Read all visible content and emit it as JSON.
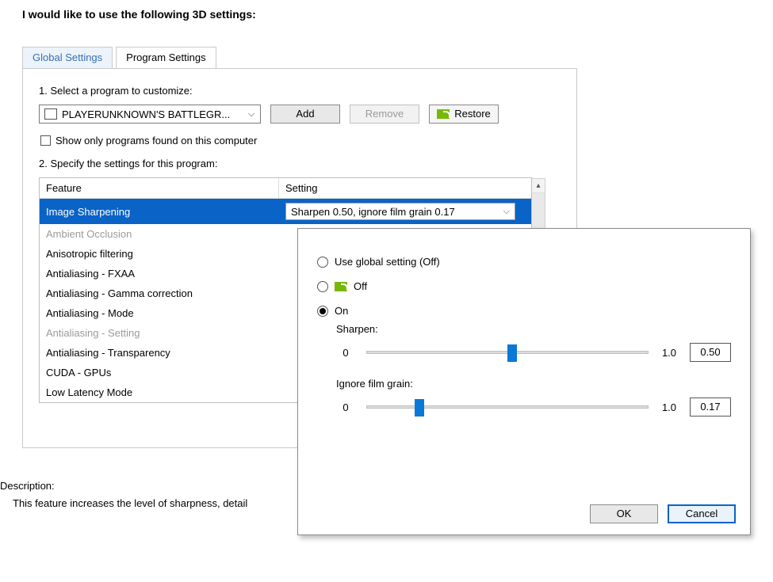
{
  "heading": "I would like to use the following 3D settings:",
  "tabs": {
    "global": "Global Settings",
    "program": "Program Settings"
  },
  "step1": "1. Select a program to customize:",
  "program_combo": "PLAYERUNKNOWN'S BATTLEGR...",
  "buttons": {
    "add": "Add",
    "remove": "Remove",
    "restore": "Restore",
    "ok": "OK",
    "cancel": "Cancel"
  },
  "show_only": "Show only programs found on this computer",
  "step2": "2. Specify the settings for this program:",
  "table": {
    "feature_header": "Feature",
    "setting_header": "Setting",
    "rows": [
      {
        "name": "Image Sharpening",
        "setting": "Sharpen 0.50, ignore film grain 0.17",
        "selected": true
      },
      {
        "name": "Ambient Occlusion",
        "gray": true
      },
      {
        "name": "Anisotropic filtering"
      },
      {
        "name": "Antialiasing - FXAA"
      },
      {
        "name": "Antialiasing - Gamma correction"
      },
      {
        "name": "Antialiasing - Mode"
      },
      {
        "name": "Antialiasing - Setting",
        "gray": true
      },
      {
        "name": "Antialiasing - Transparency"
      },
      {
        "name": "CUDA - GPUs"
      },
      {
        "name": "Low Latency Mode"
      }
    ]
  },
  "description_label": "Description:",
  "description_text": "This feature increases the level of sharpness, detail",
  "popup": {
    "opt_global": "Use global setting (Off)",
    "opt_off": "Off",
    "opt_on": "On",
    "sharpen_label": "Sharpen:",
    "grain_label": "Ignore film grain:",
    "min": "0",
    "max": "1.0",
    "sharpen_value": "0.50",
    "grain_value": "0.17"
  }
}
